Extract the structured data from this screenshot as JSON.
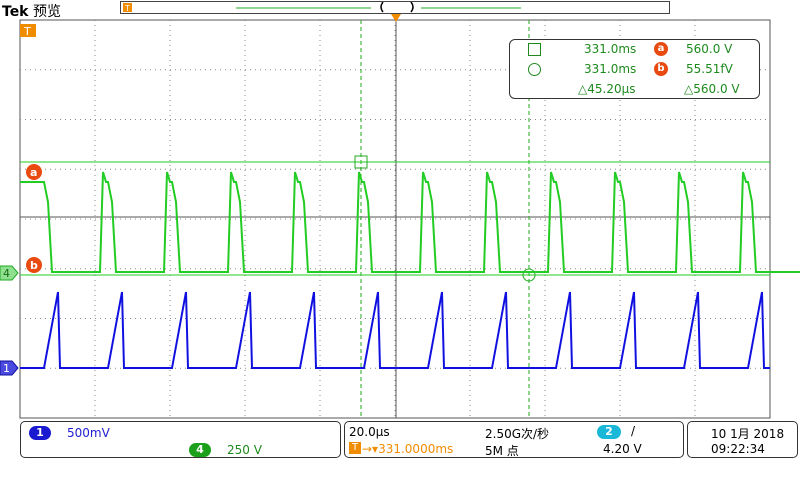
{
  "header": {
    "brand": "Tek",
    "mode": "预览"
  },
  "colors": {
    "ch1": "#1010e0",
    "ch4": "#22cc22",
    "cursor": "#e84a10",
    "trigger": "#f08c00",
    "meas_text": "#1e8a1e",
    "ch1_text": "#2020d0",
    "ch4_text": "#1e8a1e",
    "ch2_text": "#1aa0c0"
  },
  "markers": {
    "trigger_level": "T",
    "ch4_marker": "4",
    "ch1_marker": "1",
    "cursor_a": "a",
    "cursor_b": "b"
  },
  "measurements": {
    "row1": {
      "time": "331.0ms",
      "label": "a",
      "value": "560.0 V"
    },
    "row2": {
      "time": "331.0ms",
      "label": "b",
      "value": "55.51fV"
    },
    "row3": {
      "dt": "△45.20µs",
      "dv": "△560.0 V"
    }
  },
  "status": {
    "ch1_badge": "1",
    "ch1_scale": "500mV",
    "ch4_badge": "4",
    "ch4_scale": "250 V",
    "timebase": "20.0µs",
    "sample_rate": "2.50G次/秒",
    "trigger_pos": "→▾331.0000ms",
    "record_length": "5M 点",
    "trig_source_badge": "2",
    "trig_slope": "/",
    "trig_level": "4.20 V",
    "date": "10 1月 2018",
    "time": "09:22:34"
  }
}
